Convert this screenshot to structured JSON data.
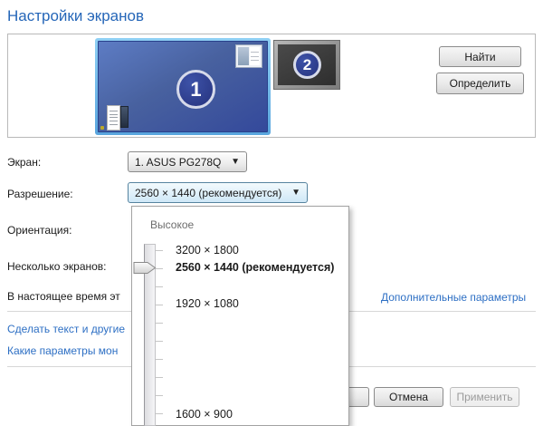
{
  "title": "Настройки экранов",
  "preview": {
    "monitor1_number": "1",
    "monitor2_number": "2",
    "find_button": "Найти",
    "identify_button": "Определить"
  },
  "fields": {
    "screen_label": "Экран:",
    "screen_value": "1. ASUS PG278Q",
    "resolution_label": "Разрешение:",
    "resolution_value": "2560 × 1440 (рекомендуется)",
    "orientation_label": "Ориентация:",
    "multi_display_label": "Несколько экранов:",
    "primary_display_text": "В настоящее время эт",
    "link_make_text": "Сделать текст и другие",
    "link_what_params": "Какие параметры мон",
    "link_advanced": "Дополнительные параметры"
  },
  "resolution_menu": {
    "group_label": "Высокое",
    "options": [
      {
        "label": "3200 × 1800",
        "selected": false
      },
      {
        "label": "2560 × 1440 (рекомендуется)",
        "selected": true
      },
      {
        "label": "1920 × 1080",
        "selected": false
      },
      {
        "label": "1600 × 900",
        "selected": false
      }
    ]
  },
  "footer": {
    "cancel_button": "Отмена",
    "apply_button": "Применить",
    "apply_disabled": true
  },
  "icons": {
    "dropdown_arrow": "▼"
  },
  "colors": {
    "title_blue": "#2566b8",
    "link_blue": "#2d6fc4",
    "monitor_selected_frame": "#6fb8e8",
    "monitor_screen_blue": "#3f57a8",
    "monitor2_screen_gray": "#3a3a3a",
    "combo_active_border": "#56839f",
    "disabled_text": "#9b9b9b"
  }
}
